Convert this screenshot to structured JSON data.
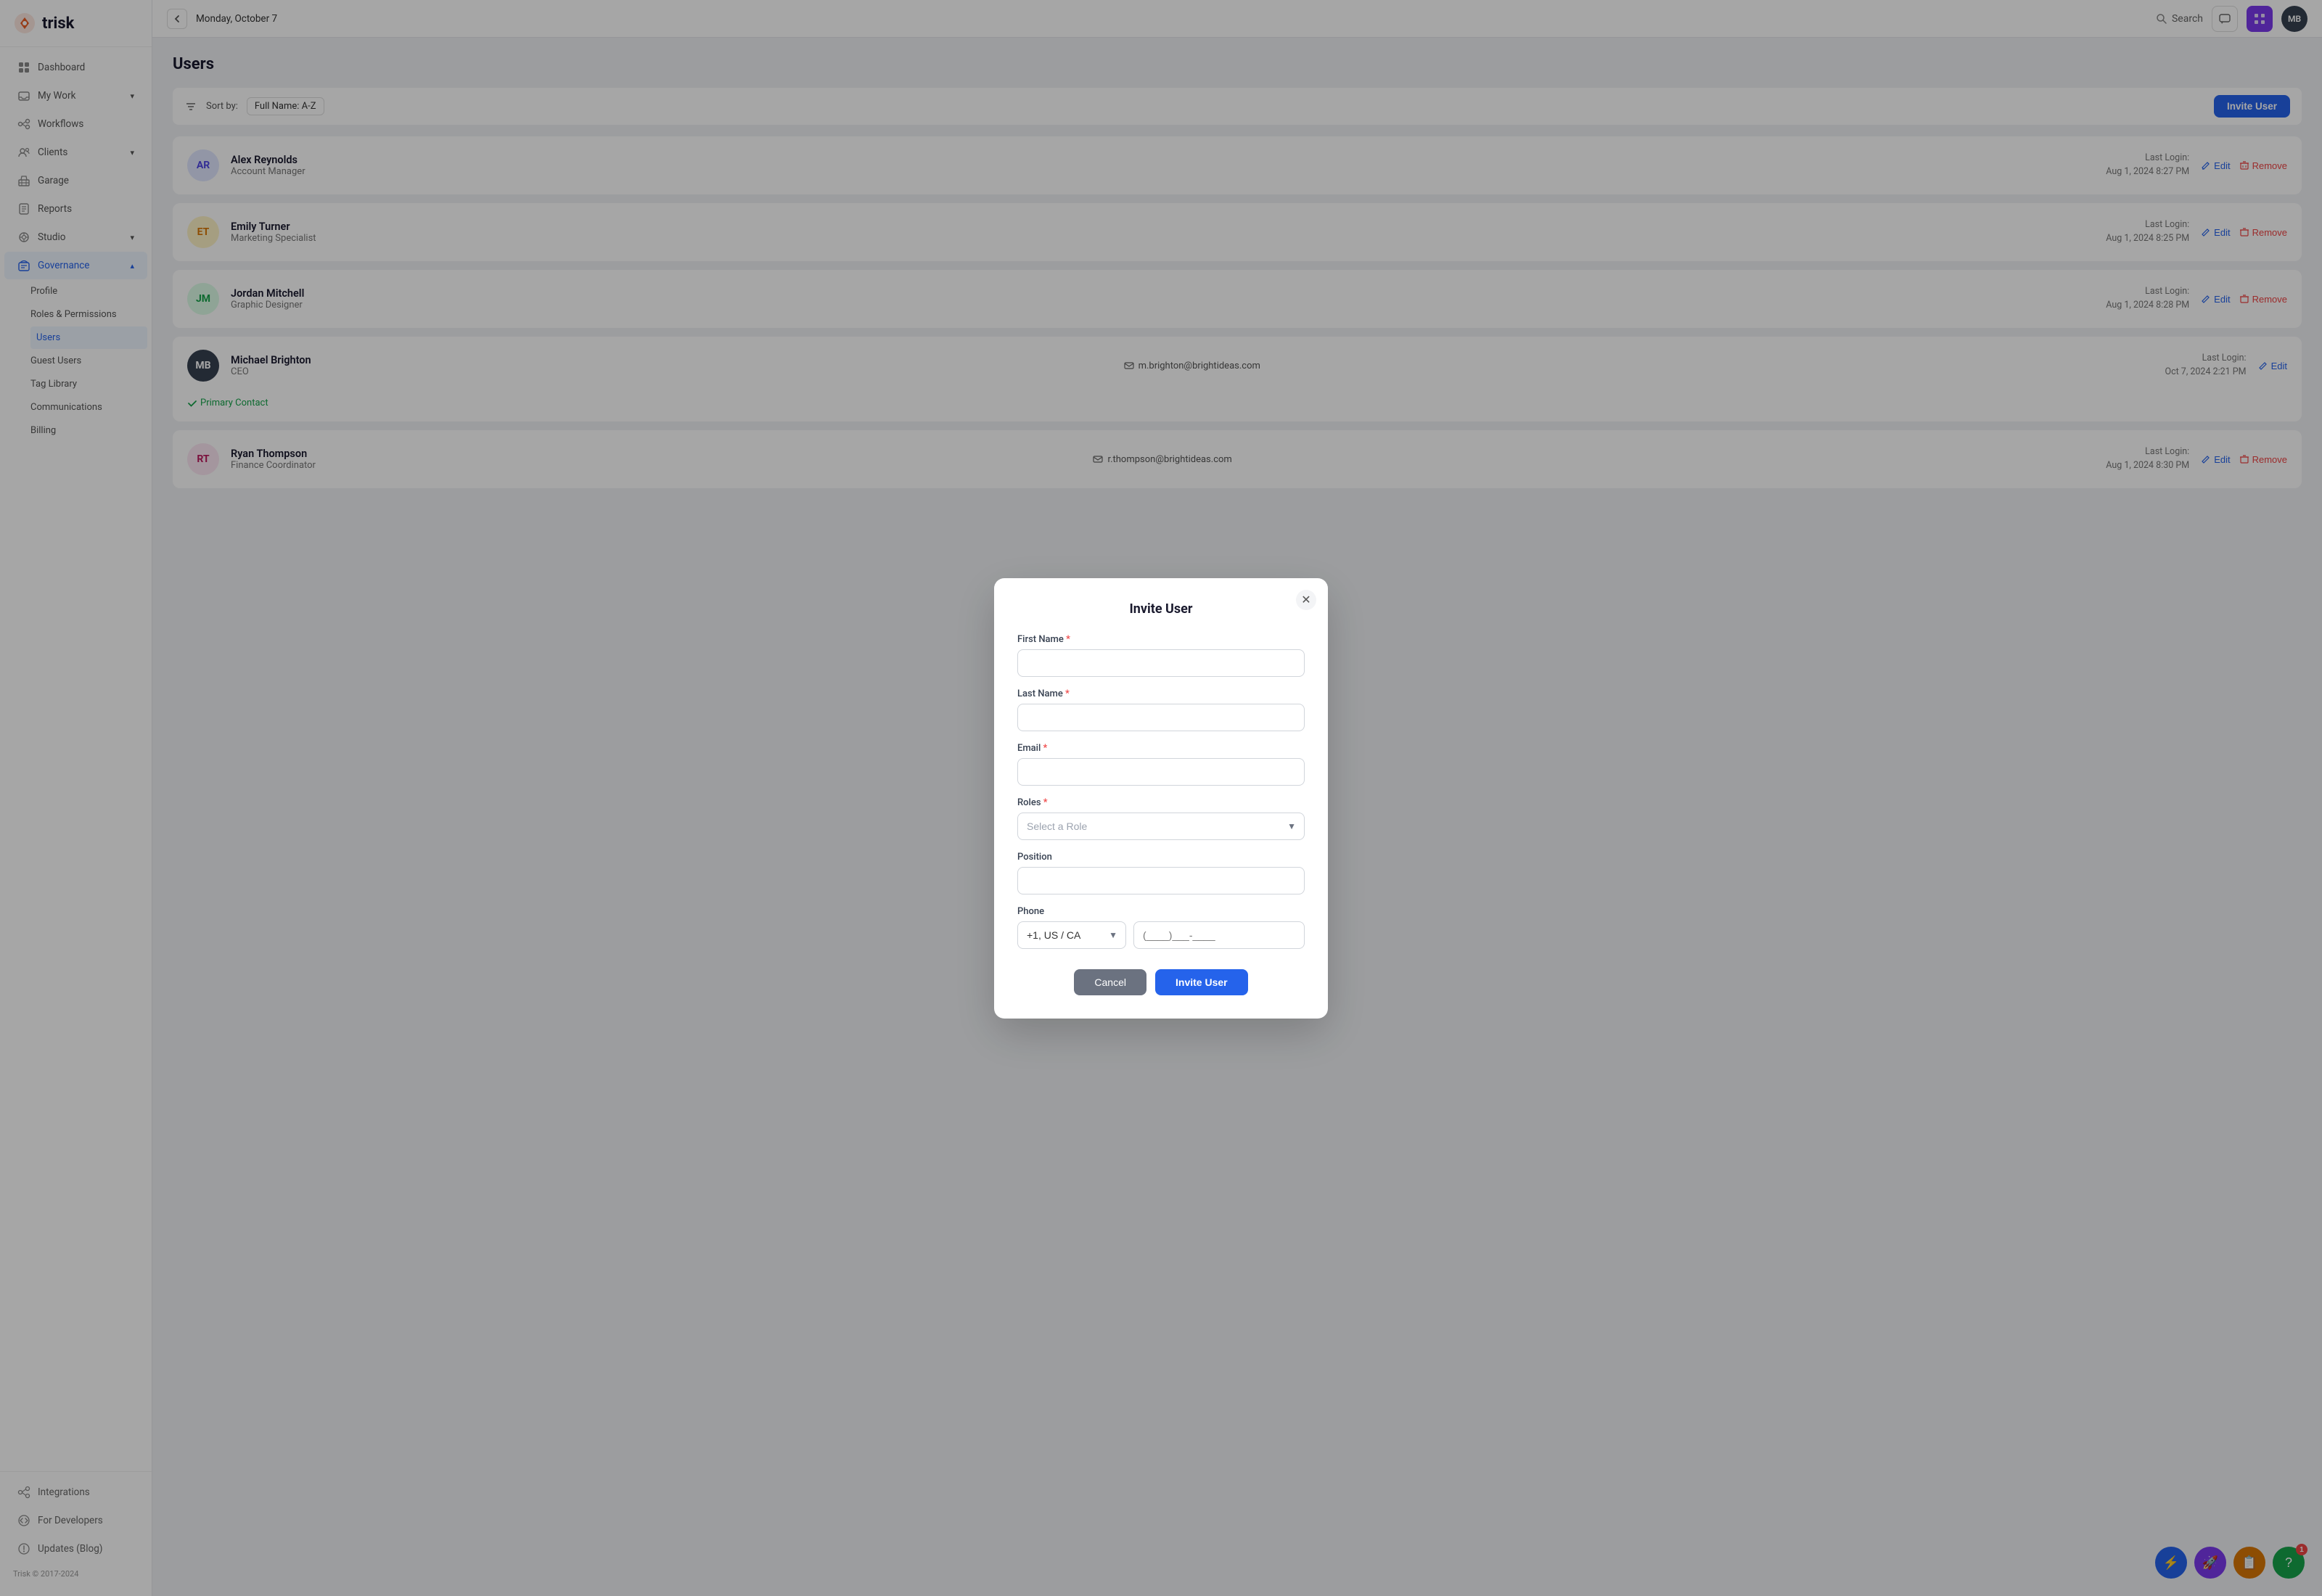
{
  "app": {
    "name": "trisk",
    "logo_color": "#e85d26"
  },
  "topbar": {
    "back_label": "‹",
    "date": "Monday, October 7",
    "search_label": "Search",
    "user_initials": "MB"
  },
  "sidebar": {
    "items": [
      {
        "id": "dashboard",
        "label": "Dashboard",
        "icon": "grid-icon",
        "active": false
      },
      {
        "id": "my-work",
        "label": "My Work",
        "icon": "inbox-icon",
        "active": false,
        "has_chevron": true
      },
      {
        "id": "workflows",
        "label": "Workflows",
        "icon": "workflow-icon",
        "active": false
      },
      {
        "id": "clients",
        "label": "Clients",
        "icon": "users-icon",
        "active": false,
        "has_chevron": true
      },
      {
        "id": "garage",
        "label": "Garage",
        "icon": "garage-icon",
        "active": false
      },
      {
        "id": "reports",
        "label": "Reports",
        "icon": "reports-icon",
        "active": false
      },
      {
        "id": "studio",
        "label": "Studio",
        "icon": "studio-icon",
        "active": false,
        "has_chevron": true
      },
      {
        "id": "governance",
        "label": "Governance",
        "icon": "governance-icon",
        "active": true,
        "has_chevron": true
      }
    ],
    "governance_sub": [
      {
        "id": "profile",
        "label": "Profile",
        "active": false
      },
      {
        "id": "roles-permissions",
        "label": "Roles & Permissions",
        "active": false
      },
      {
        "id": "users",
        "label": "Users",
        "active": true
      },
      {
        "id": "guest-users",
        "label": "Guest Users",
        "active": false
      },
      {
        "id": "tag-library",
        "label": "Tag Library",
        "active": false
      },
      {
        "id": "communications",
        "label": "Communications",
        "active": false
      },
      {
        "id": "billing",
        "label": "Billing",
        "active": false
      }
    ],
    "footer_items": [
      {
        "id": "integrations",
        "label": "Integrations",
        "icon": "integrations-icon"
      },
      {
        "id": "developers",
        "label": "For Developers",
        "icon": "developers-icon"
      },
      {
        "id": "updates",
        "label": "Updates (Blog)",
        "icon": "updates-icon"
      }
    ],
    "copyright": "Trisk © 2017-2024"
  },
  "page": {
    "title": "Users",
    "sort_label": "Sort by:",
    "sort_value": "Full Name: A-Z",
    "invite_button": "Invite User"
  },
  "users": [
    {
      "initials": "AR",
      "name": "Alex Reynolds",
      "role": "Account Manager",
      "email": "",
      "last_login_label": "Last Login:",
      "last_login": "Aug 1, 2024 8:27 PM",
      "show_edit": true,
      "show_remove": true,
      "primary_contact": false
    },
    {
      "initials": "ET",
      "name": "Emily Turner",
      "role": "Marketing Specialist",
      "email": "",
      "last_login_label": "Last Login:",
      "last_login": "Aug 1, 2024 8:25 PM",
      "show_edit": true,
      "show_remove": true,
      "primary_contact": false
    },
    {
      "initials": "JM",
      "name": "Jordan Mitchell",
      "role": "Graphic Designer",
      "email": "",
      "last_login_label": "Last Login:",
      "last_login": "Aug 1, 2024 8:28 PM",
      "show_edit": true,
      "show_remove": true,
      "primary_contact": false
    },
    {
      "initials": "MB",
      "name": "Michael Brighton",
      "role": "CEO",
      "email": "m.brighton@brightideas.com",
      "last_login_label": "Last Login:",
      "last_login": "Oct 7, 2024 2:21 PM",
      "show_edit": true,
      "show_remove": false,
      "primary_contact": true,
      "primary_contact_label": "Primary Contact"
    },
    {
      "initials": "RT",
      "name": "Ryan Thompson",
      "role": "Finance Coordinator",
      "email": "r.thompson@brightideas.com",
      "last_login_label": "Last Login:",
      "last_login": "Aug 1, 2024 8:30 PM",
      "show_edit": true,
      "show_remove": true,
      "primary_contact": false
    }
  ],
  "modal": {
    "title": "Invite User",
    "first_name_label": "First Name",
    "last_name_label": "Last Name",
    "email_label": "Email",
    "roles_label": "Roles",
    "roles_placeholder": "Select a Role",
    "position_label": "Position",
    "phone_label": "Phone",
    "phone_country": "+1, US / CA",
    "phone_placeholder": "(____)___-____",
    "cancel_label": "Cancel",
    "invite_label": "Invite User"
  },
  "fabs": [
    {
      "id": "fab-blue",
      "color": "#2563eb",
      "icon": "⚡"
    },
    {
      "id": "fab-purple",
      "color": "#7c3aed",
      "icon": "🚀"
    },
    {
      "id": "fab-yellow",
      "color": "#d97706",
      "icon": "📋"
    },
    {
      "id": "fab-green",
      "color": "#16a34a",
      "icon": "?",
      "badge": "1"
    }
  ],
  "buttons": {
    "edit_label": "Edit",
    "remove_label": "Remove"
  }
}
